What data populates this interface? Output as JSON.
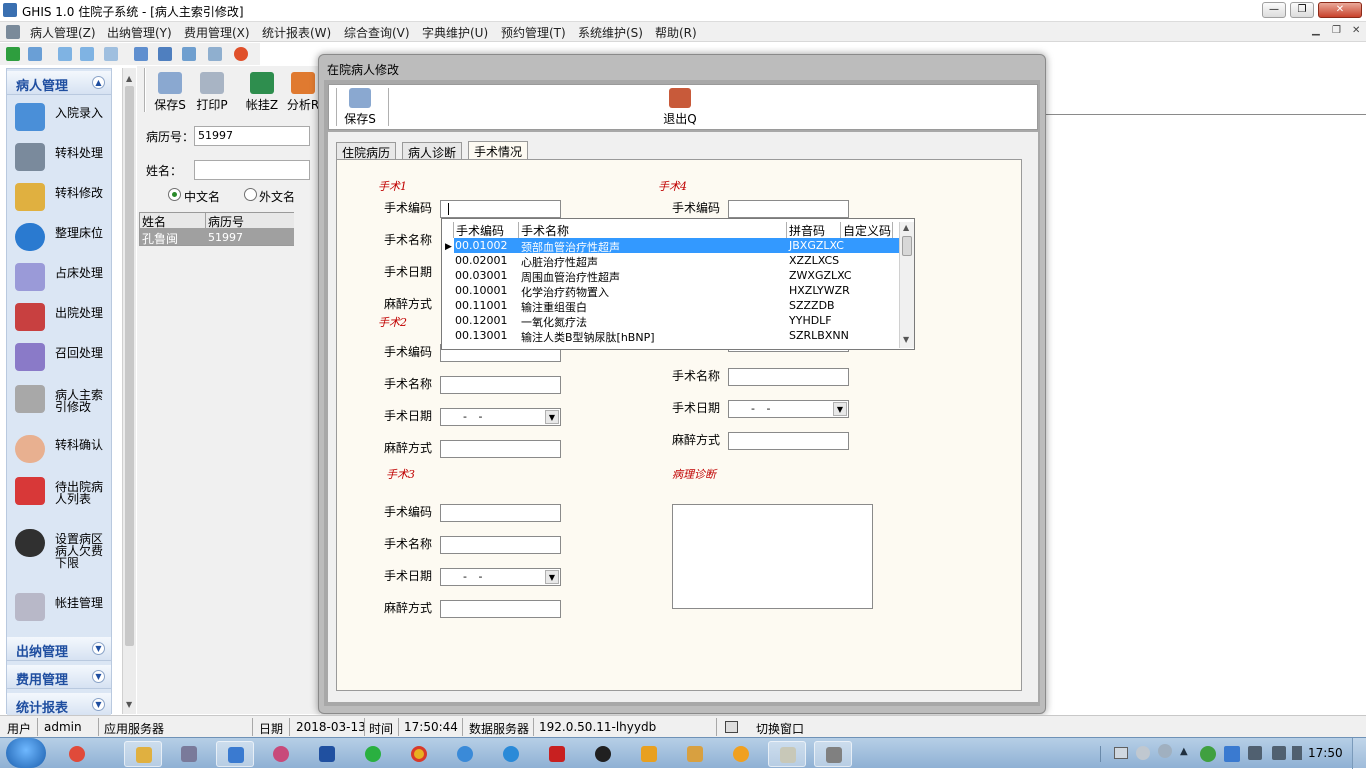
{
  "window": {
    "title": "GHIS 1.0  住院子系统 - [病人主索引修改]"
  },
  "menu": [
    "病人管理(Z)",
    "出纳管理(Y)",
    "费用管理(X)",
    "统计报表(W)",
    "综合查询(V)",
    "字典维护(U)",
    "预约管理(T)",
    "系统维护(S)",
    "帮助(R)"
  ],
  "sidebar": {
    "section": "病人管理",
    "items": [
      "入院录入",
      "转科处理",
      "转科修改",
      "整理床位",
      "占床处理",
      "出院处理",
      "召回处理",
      "病人主索引修改",
      "转科确认",
      "待出院病人列表",
      "设置病区病人欠费下限",
      "帐挂管理"
    ],
    "bottom_sections": [
      "出纳管理",
      "费用管理",
      "统计报表"
    ]
  },
  "midpane": {
    "toolbar": [
      "保存S",
      "打印P",
      "帐挂Z",
      "分析R"
    ],
    "record_no_label": "病历号：",
    "record_no_value": "51997",
    "name_label": "姓名：",
    "name_value": "",
    "radio_cn": "中文名",
    "radio_foreign": "外文名",
    "grid_headers": [
      "姓名",
      "病历号"
    ],
    "grid_row": [
      "孔鲁闽",
      "51997"
    ]
  },
  "dialog": {
    "title": "在院病人修改",
    "save_label": "保存S",
    "exit_label": "退出Q",
    "tabs": [
      "住院病历",
      "病人诊断",
      "手术情况"
    ],
    "sections": [
      "手术1",
      "手术2",
      "手术3",
      "手术4",
      "病理诊断"
    ],
    "labels": {
      "code": "手术编码",
      "name": "手术名称",
      "date": "手术日期",
      "anesthesia": "麻醉方式"
    },
    "date_placeholder": "-  -"
  },
  "popup": {
    "headers": [
      "手术编码",
      "手术名称",
      "拼音码",
      "自定义码"
    ],
    "rows": [
      [
        "00.01002",
        "颈部血管治疗性超声",
        "JBXGZLXC",
        ""
      ],
      [
        "00.02001",
        "心脏治疗性超声",
        "XZZLXCS",
        ""
      ],
      [
        "00.03001",
        "周围血管治疗性超声",
        "ZWXGZLXC",
        ""
      ],
      [
        "00.10001",
        "化学治疗药物置入",
        "HXZLYWZR",
        ""
      ],
      [
        "00.11001",
        "输注重组蛋白",
        "SZZZDB",
        ""
      ],
      [
        "00.12001",
        "一氧化氮疗法",
        "YYHDLF",
        ""
      ],
      [
        "00.13001",
        "输注人类B型钠尿肽[hBNP]",
        "SZRLBXNN",
        ""
      ]
    ]
  },
  "statusbar": {
    "user_label": "用户",
    "user": "admin",
    "app_server": "应用服务器",
    "date_label": "日期",
    "date": "2018-03-13",
    "time_label": "时间",
    "time": "17:50:44",
    "db_label": "数据服务器",
    "db": "192.0.50.11-lhyydb",
    "switch": "切换窗口"
  },
  "taskbar": {
    "clock": "17:50"
  },
  "colors": {
    "accent": "#3399ff",
    "section_red": "#c00000",
    "sidebar_blue": "#1f4ea0"
  }
}
